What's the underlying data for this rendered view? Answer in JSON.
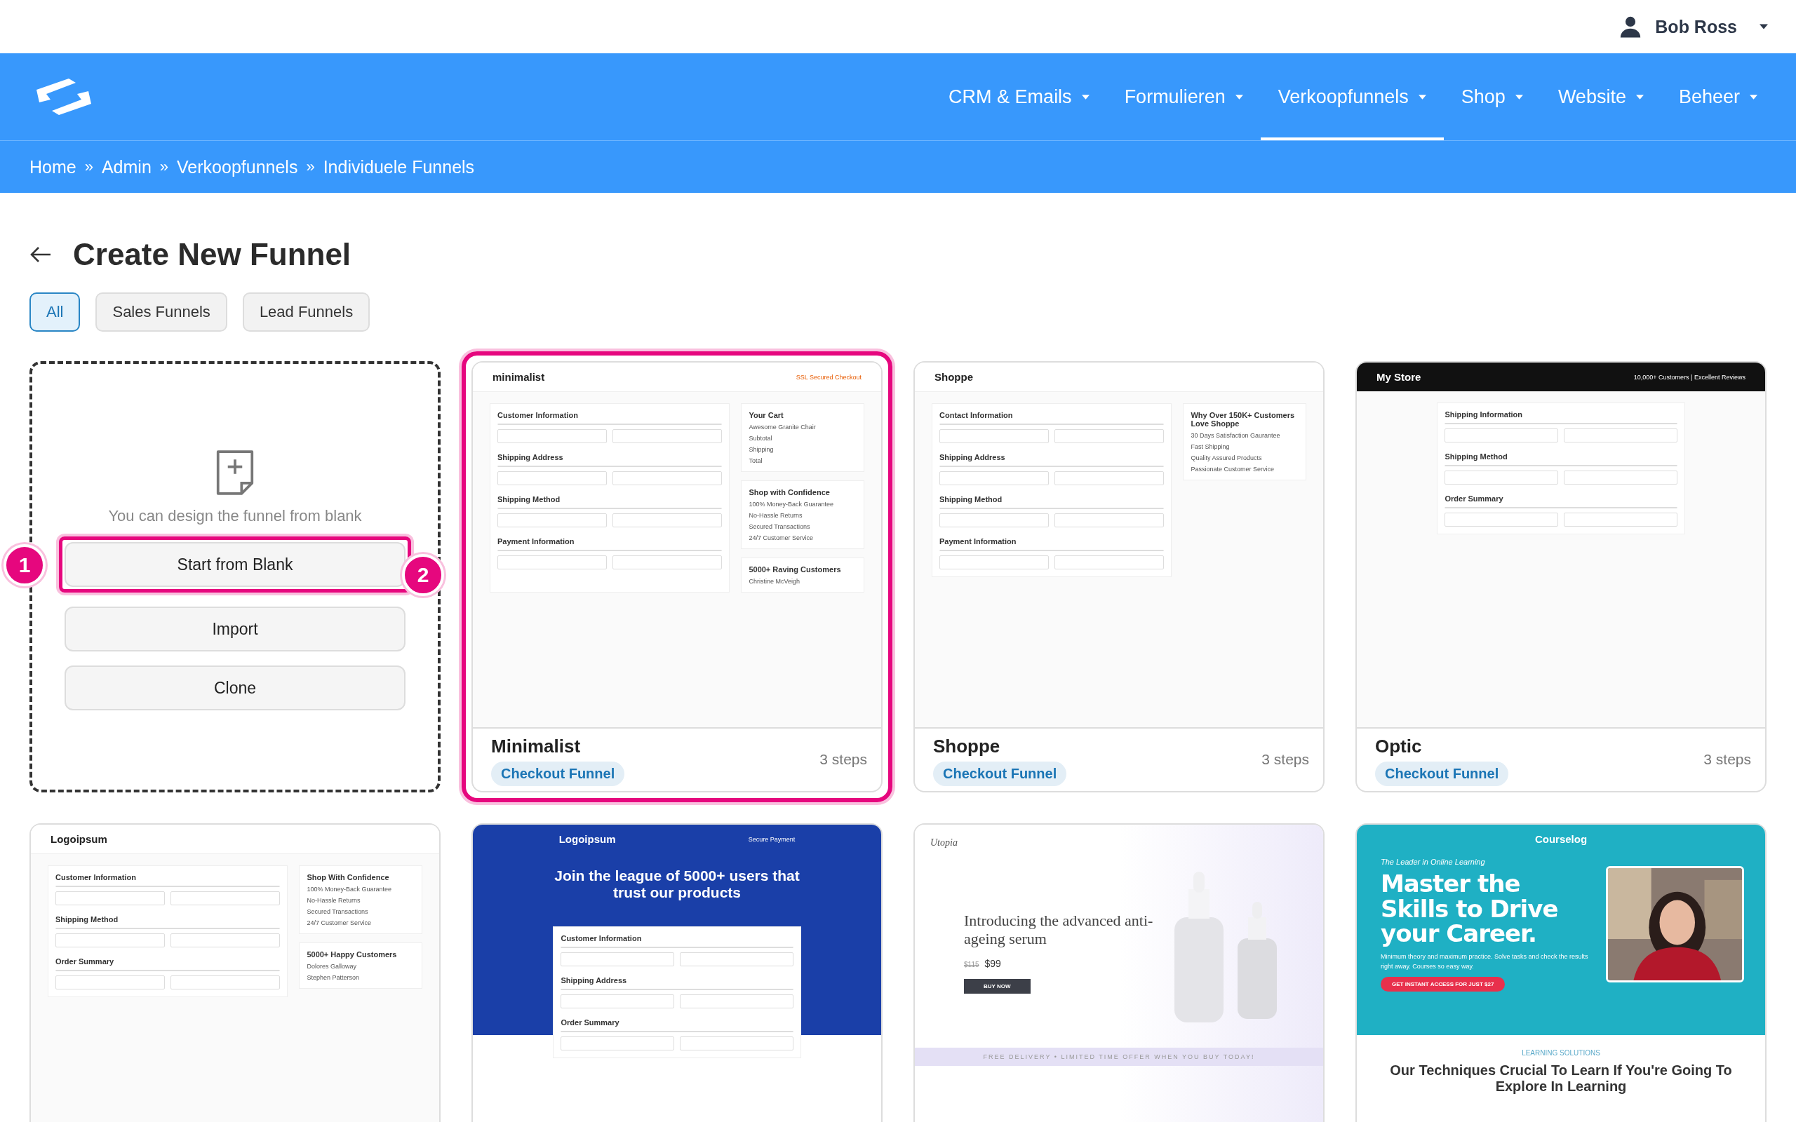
{
  "user": {
    "name": "Bob Ross"
  },
  "nav": [
    {
      "label": "CRM & Emails",
      "selected": false
    },
    {
      "label": "Formulieren",
      "selected": false
    },
    {
      "label": "Verkoopfunnels",
      "selected": true
    },
    {
      "label": "Shop",
      "selected": false
    },
    {
      "label": "Website",
      "selected": false
    },
    {
      "label": "Beheer",
      "selected": false
    }
  ],
  "breadcrumb": [
    "Home",
    "Admin",
    "Verkoopfunnels",
    "Individuele Funnels"
  ],
  "breadcrumb_separator": "»",
  "page_title": "Create New Funnel",
  "filters": [
    {
      "label": "All",
      "selected": true
    },
    {
      "label": "Sales Funnels",
      "selected": false
    },
    {
      "label": "Lead Funnels",
      "selected": false
    }
  ],
  "blank": {
    "text": "You can design the funnel from blank",
    "buttons": [
      "Start from Blank",
      "Import",
      "Clone"
    ],
    "markers": [
      "1",
      "2"
    ]
  },
  "cards": [
    {
      "name": "Minimalist",
      "tag": "Checkout Funnel",
      "steps": "3 steps",
      "selected": true,
      "preview": {
        "kind": "checkout",
        "brand": "minimalist",
        "note": "SSL Secured Checkout",
        "sections": [
          "Customer Information",
          "Shipping Address",
          "Shipping Method",
          "Payment Information"
        ],
        "side": [
          {
            "title": "Your Cart",
            "lines": [
              "Awesome Granite Chair",
              "Subtotal",
              "Shipping",
              "Total"
            ]
          },
          {
            "title": "Shop with Confidence",
            "lines": [
              "100% Money-Back Guarantee",
              "No-Hassle Returns",
              "Secured Transactions",
              "24/7 Customer Service"
            ]
          },
          {
            "title": "5000+ Raving Customers",
            "lines": [
              "Christine McVeigh"
            ]
          }
        ]
      }
    },
    {
      "name": "Shoppe",
      "tag": "Checkout Funnel",
      "steps": "3 steps",
      "selected": false,
      "preview": {
        "kind": "checkout",
        "brand": "Shoppe",
        "sections": [
          "Contact Information",
          "Shipping Address",
          "Shipping Method",
          "Payment Information"
        ],
        "side": [
          {
            "title": "Why Over 150K+ Customers Love Shoppe",
            "lines": [
              "30 Days Satisfaction Gaurantee",
              "Fast Shipping",
              "Quality Assured Products",
              "Passionate Customer Service"
            ]
          }
        ]
      }
    },
    {
      "name": "Optic",
      "tag": "Checkout Funnel",
      "steps": "3 steps",
      "selected": false,
      "preview": {
        "kind": "checkout",
        "dark_header": true,
        "brand": "My Store",
        "note": "10,000+ Customers | Excellent Reviews",
        "sections": [
          "Shipping Information",
          "Shipping Method",
          "Order Summary"
        ]
      }
    },
    {
      "selected": false,
      "preview": {
        "kind": "checkout",
        "brand": "Logoipsum",
        "sections": [
          "Customer Information",
          "Shipping Method",
          "Order Summary"
        ],
        "side": [
          {
            "title": "Shop With Confidence",
            "lines": [
              "100% Money-Back Guarantee",
              "No-Hassle Returns",
              "Secured Transactions",
              "24/7 Customer Service"
            ]
          },
          {
            "title": "5000+ Happy Customers",
            "lines": [
              "Dolores Galloway",
              "Stephen Patterson"
            ]
          }
        ]
      }
    },
    {
      "selected": false,
      "preview": {
        "kind": "checkout",
        "brand": "Logoipsum",
        "note": "Secure Payment",
        "heading": "Join the league of 5000+ users that trust our products",
        "sections": [
          "Customer Information",
          "Shipping Address",
          "Order Summary"
        ]
      }
    },
    {
      "selected": false,
      "preview": {
        "kind": "product",
        "brand": "Utopia",
        "heading": "Introducing the advanced anti-ageing serum",
        "old_price": "$115",
        "price": "$99",
        "button": "BUY NOW",
        "banner": "FREE DELIVERY • LIMITED TIME OFFER WHEN YOU BUY TODAY!"
      }
    },
    {
      "selected": false,
      "preview": {
        "kind": "course",
        "brand": "Courselog",
        "tagline": "The Leader in Online Learning",
        "heading": "Master the Skills to Drive your Career.",
        "body": "Minimum theory and maximum practice. Solve tasks and check the results right away. Courses so easy way.",
        "button": "GET INSTANT ACCESS FOR JUST $27",
        "eyebrow": "LEARNING SOLUTIONS",
        "subheading": "Our Techniques Crucial To Learn If You're Going To Explore In Learning"
      }
    }
  ]
}
